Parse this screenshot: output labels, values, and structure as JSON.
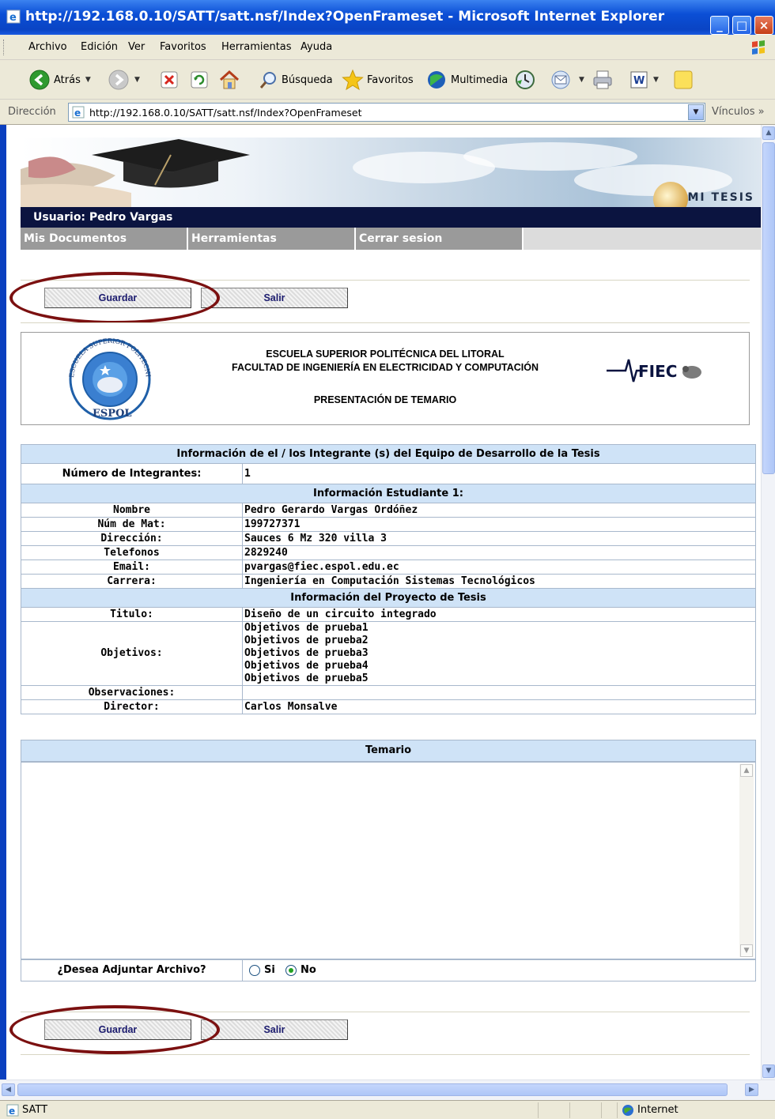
{
  "window": {
    "title": "http://192.168.0.10/SATT/satt.nsf/Index?OpenFrameset - Microsoft Internet Explorer"
  },
  "menu": [
    "Archivo",
    "Edición",
    "Ver",
    "Favoritos",
    "Herramientas",
    "Ayuda"
  ],
  "toolbar": {
    "back": "Atrás",
    "search": "Búsqueda",
    "favorites": "Favoritos",
    "media": "Multimedia"
  },
  "address": {
    "label": "Dirección",
    "url": "http://192.168.0.10/SATT/satt.nsf/Index?OpenFrameset",
    "links": "Vínculos"
  },
  "banner": {
    "brand": "MI TESIS"
  },
  "user": {
    "label": "Usuario: Pedro Vargas"
  },
  "nav": [
    "Mis Documentos",
    "Herramientas",
    "Cerrar sesion"
  ],
  "buttons": {
    "save": "Guardar",
    "exit": "Salir"
  },
  "header": {
    "line1": "ESCUELA SUPERIOR POLITÉCNICA DEL LITORAL",
    "line2": "FACULTAD DE INGENIERÍA EN ELECTRICIDAD Y COMPUTACIÓN",
    "line3": "PRESENTACIÓN DE TEMARIO",
    "seal_text": "ESCUELA SUPERIOR POLITECNICA DEL LITORAL",
    "seal_abbr": "ESPOL",
    "fiec": "FIEC"
  },
  "team": {
    "section": "Información de el / los Integrante (s) del Equipo de Desarrollo de la Tesis",
    "count_label": "Número de Integrantes:",
    "count": "1"
  },
  "student": {
    "section": "Información Estudiante 1:",
    "rows": [
      {
        "label": "Nombre",
        "value": "Pedro Gerardo Vargas Ordóñez"
      },
      {
        "label": "Núm de Mat:",
        "value": "199727371"
      },
      {
        "label": "Dirección:",
        "value": "Sauces 6 Mz 320 villa 3"
      },
      {
        "label": "Telefonos",
        "value": "2829240"
      },
      {
        "label": "Email:",
        "value": "pvargas@fiec.espol.edu.ec"
      },
      {
        "label": "Carrera:",
        "value": "Ingeniería en Computación Sistemas Tecnológicos"
      }
    ]
  },
  "project": {
    "section": "Información del Proyecto de Tesis",
    "title_label": "Titulo:",
    "title": "Diseño de un circuito integrado",
    "objectives_label": "Objetivos:",
    "objectives": [
      "Objetivos de prueba1",
      "Objetivos de prueba2",
      "Objetivos de prueba3",
      "Objetivos de prueba4",
      "Objetivos de prueba5"
    ],
    "observations_label": "Observaciones:",
    "observations": "",
    "director_label": "Director:",
    "director": "Carlos Monsalve"
  },
  "temario": {
    "label": "Temario",
    "value": ""
  },
  "attach": {
    "question": "¿Desea Adjuntar Archivo?",
    "yes": "Si",
    "no": "No",
    "selected": "No"
  },
  "status": {
    "text": "SATT",
    "zone": "Internet"
  },
  "colors": {
    "annotation": "#7b1010",
    "section_bg": "#cfe3f7",
    "userbar_bg": "#0b1440",
    "nav_bg": "#9a9a9a"
  }
}
